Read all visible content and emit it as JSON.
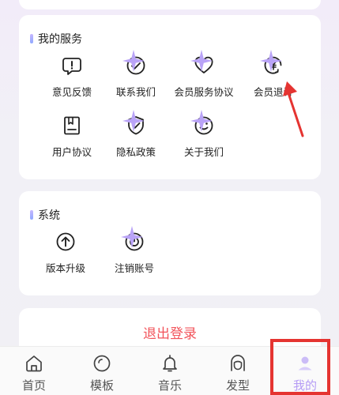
{
  "services": {
    "title": "我的服务",
    "items": [
      {
        "label": "意见反馈",
        "icon": "feedback-icon"
      },
      {
        "label": "联系我们",
        "icon": "contact-icon"
      },
      {
        "label": "会员服务协议",
        "icon": "heart-agreement-icon"
      },
      {
        "label": "会员退订",
        "icon": "yen-refund-icon"
      },
      {
        "label": "用户协议",
        "icon": "document-icon"
      },
      {
        "label": "隐私政策",
        "icon": "shield-icon"
      },
      {
        "label": "关于我们",
        "icon": "smile-icon"
      }
    ]
  },
  "system": {
    "title": "系统",
    "items": [
      {
        "label": "版本升级",
        "icon": "upgrade-icon"
      },
      {
        "label": "注销账号",
        "icon": "power-icon"
      }
    ]
  },
  "logout": {
    "label": "退出登录",
    "color": "#f2545b"
  },
  "tabbar": {
    "active": "我的",
    "active_color": "#b59cf5",
    "items": [
      {
        "label": "首页",
        "icon": "home-icon"
      },
      {
        "label": "模板",
        "icon": "template-icon"
      },
      {
        "label": "音乐",
        "icon": "bell-icon"
      },
      {
        "label": "发型",
        "icon": "hairstyle-icon"
      },
      {
        "label": "我的",
        "icon": "profile-icon"
      }
    ]
  },
  "annotation_color": "#e53431"
}
